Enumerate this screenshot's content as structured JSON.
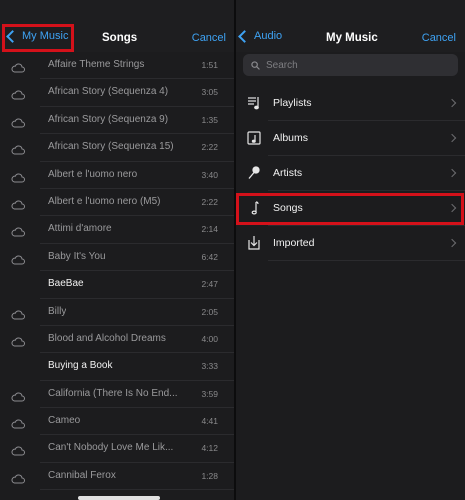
{
  "songs_pane": {
    "back_label": "My Music",
    "title": "Songs",
    "cancel_label": "Cancel",
    "songs": [
      {
        "title": "Affaire Theme Strings",
        "duration": "1:51",
        "cloud": true
      },
      {
        "title": "African Story (Sequenza 4)",
        "duration": "3:05",
        "cloud": true
      },
      {
        "title": "African Story (Sequenza 9)",
        "duration": "1:35",
        "cloud": true
      },
      {
        "title": "African Story (Sequenza 15)",
        "duration": "2:22",
        "cloud": true
      },
      {
        "title": "Albert e l'uomo nero",
        "duration": "3:40",
        "cloud": true
      },
      {
        "title": "Albert e l'uomo nero (M5)",
        "duration": "2:22",
        "cloud": true
      },
      {
        "title": "Attimi d'amore",
        "duration": "2:14",
        "cloud": true
      },
      {
        "title": "Baby It's You",
        "duration": "6:42",
        "cloud": true
      },
      {
        "title": "BaeBae",
        "duration": "2:47",
        "cloud": false
      },
      {
        "title": "Billy",
        "duration": "2:05",
        "cloud": true
      },
      {
        "title": "Blood and Alcohol Dreams",
        "duration": "4:00",
        "cloud": true
      },
      {
        "title": "Buying a Book",
        "duration": "3:33",
        "cloud": false
      },
      {
        "title": "California (There Is No End...",
        "duration": "3:59",
        "cloud": true
      },
      {
        "title": "Cameo",
        "duration": "4:41",
        "cloud": true
      },
      {
        "title": "Can't Nobody Love Me Lik...",
        "duration": "4:12",
        "cloud": true
      },
      {
        "title": "Cannibal Ferox",
        "duration": "1:28",
        "cloud": true
      }
    ]
  },
  "music_pane": {
    "back_label": "Audio",
    "title": "My Music",
    "cancel_label": "Cancel",
    "search_placeholder": "Search",
    "menu": [
      {
        "label": "Playlists",
        "icon": "playlist-icon"
      },
      {
        "label": "Albums",
        "icon": "album-icon"
      },
      {
        "label": "Artists",
        "icon": "microphone-icon"
      },
      {
        "label": "Songs",
        "icon": "music-note-icon"
      },
      {
        "label": "Imported",
        "icon": "import-icon"
      }
    ]
  },
  "colors": {
    "accent": "#3ea3f4",
    "highlight": "#d4111a",
    "background": "#1c1c1e"
  }
}
